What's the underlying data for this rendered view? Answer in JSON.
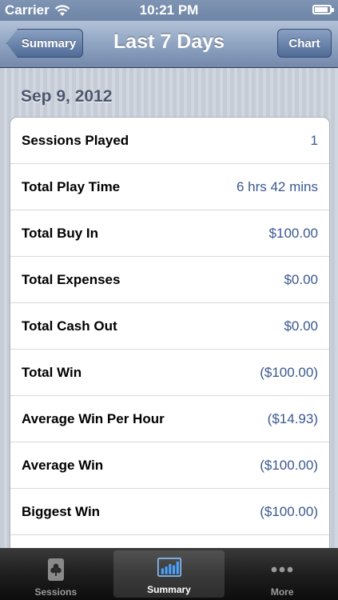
{
  "status_bar": {
    "carrier": "Carrier",
    "time": "10:21 PM"
  },
  "nav": {
    "title": "Last 7 Days",
    "back_label": "Summary",
    "chart_label": "Chart"
  },
  "section": {
    "date": "Sep 9, 2012"
  },
  "rows": [
    {
      "label": "Sessions Played",
      "value": "1"
    },
    {
      "label": "Total Play Time",
      "value": "6 hrs 42 mins"
    },
    {
      "label": "Total Buy In",
      "value": "$100.00"
    },
    {
      "label": "Total Expenses",
      "value": "$0.00"
    },
    {
      "label": "Total Cash Out",
      "value": "$0.00"
    },
    {
      "label": "Total Win",
      "value": "($100.00)"
    },
    {
      "label": "Average Win Per Hour",
      "value": "($14.93)"
    },
    {
      "label": "Average Win",
      "value": "($100.00)"
    },
    {
      "label": "Biggest Win",
      "value": "($100.00)"
    },
    {
      "label": "",
      "value": ""
    }
  ],
  "tabs": [
    {
      "label": "Sessions",
      "icon": "club-card-icon"
    },
    {
      "label": "Summary",
      "icon": "bar-chart-icon",
      "active": true
    },
    {
      "label": "More",
      "icon": "more-dots-icon"
    }
  ],
  "colors": {
    "value_text": "#3b5890",
    "nav_tint": "#7489ab"
  }
}
